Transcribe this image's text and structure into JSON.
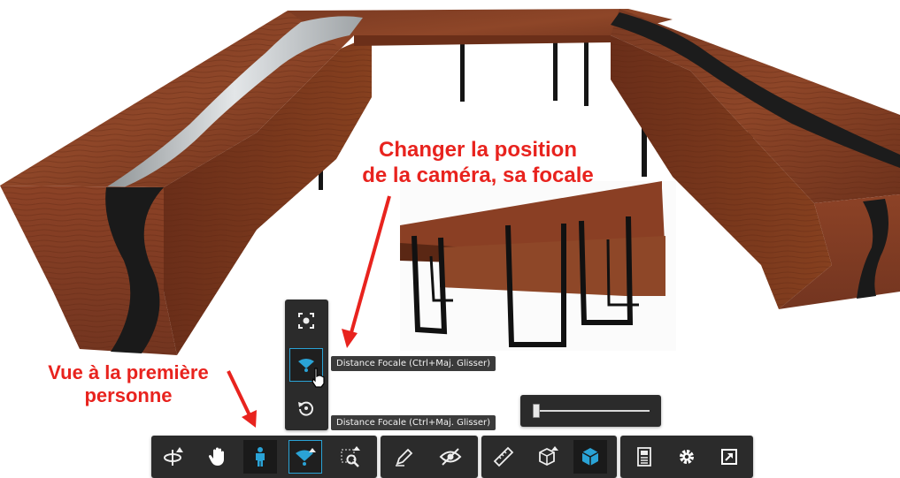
{
  "viewport": {
    "description_colors": {
      "wood": "#8a3e22",
      "wood_dark": "#5c2814",
      "resin_black": "#1c1c1c",
      "resin_glass": "#b8bcbe",
      "metal": "#111111"
    }
  },
  "annotations": {
    "camera_lines": [
      "Changer la position",
      "de la caméra, sa focale"
    ],
    "first_person_lines": [
      "Vue à la première",
      "personne"
    ],
    "color": "#e8231e"
  },
  "tooltips": {
    "focal_flyout": "Distance Focale (Ctrl+Maj. Glisser)",
    "focal_toolbar": "Distance Focale (Ctrl+Maj. Glisser)"
  },
  "camera_flyout": {
    "items": [
      {
        "icon": "fit-view-icon",
        "active": false
      },
      {
        "icon": "focal-length-icon",
        "active": true
      },
      {
        "icon": "reset-camera-icon",
        "active": false
      }
    ]
  },
  "focal_slider": {
    "value": 0.0
  },
  "toolbar": {
    "groups": [
      {
        "name": "navigation",
        "items": [
          "orbit-icon",
          "pan-hand-icon",
          "first-person-icon",
          "focal-length-icon",
          "zoom-window-icon"
        ],
        "active": "focal-length-icon",
        "pressed": "first-person-icon"
      },
      {
        "name": "edit",
        "items": [
          "markup-pen-icon",
          "hide-eye-icon"
        ]
      },
      {
        "name": "tools",
        "items": [
          "measure-ruler-icon",
          "section-box-icon",
          "model-cube-icon"
        ],
        "pressed": "model-cube-icon"
      },
      {
        "name": "settings",
        "items": [
          "properties-icon",
          "settings-gear-icon",
          "fullscreen-icon"
        ]
      }
    ],
    "accent": "#2aa3d6"
  }
}
